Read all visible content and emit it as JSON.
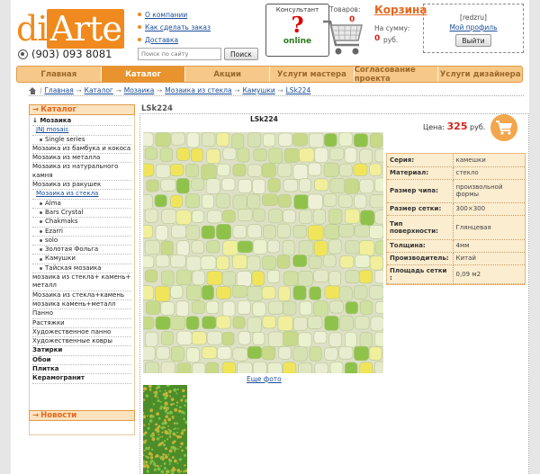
{
  "header": {
    "logo_di": "di",
    "logo_arte": "Arte",
    "phone": "(903) 093 8081",
    "links": [
      "О компании",
      "Как сделать заказ",
      "Доставка"
    ],
    "search_placeholder": "Поиск по сайту",
    "search_button": "Поиск",
    "consultant_title": "Консультант",
    "consultant_status": "online",
    "cart_title": "Корзина",
    "cart_items_label": "Товаров:",
    "cart_items_value": "0",
    "cart_sum_label": "На сумму:",
    "cart_sum_value": "0",
    "cart_sum_unit": "руб.",
    "user_name": "[redzru]",
    "user_profile": "Мой профиль",
    "logout": "Выйти"
  },
  "nav": [
    "Главная",
    "Каталог",
    "Акции",
    "Услуги мастера",
    "Согласование проекта",
    "Услуги дизайнера"
  ],
  "breadcrumb": [
    "Главная",
    "Каталог",
    "Мозаика",
    "Мозаика из стекла",
    "Камушки",
    "LSk224"
  ],
  "sidebar": {
    "title": "Каталог",
    "items": [
      {
        "label": "Мозаика",
        "level": 0,
        "bold": true,
        "arrow": true
      },
      {
        "label": "JNJ mosaic",
        "level": 1,
        "link": true
      },
      {
        "label": "Single series",
        "level": 2
      },
      {
        "label": "Мозаика из бамбука и кокоса",
        "level": 0
      },
      {
        "label": "Мозаика из металла",
        "level": 0
      },
      {
        "label": "Мозаика из натурального камня",
        "level": 0
      },
      {
        "label": "Мозаика из ракушек",
        "level": 0
      },
      {
        "label": "Мозаика из стекла",
        "level": 1,
        "link": true
      },
      {
        "label": "Alma",
        "level": 2
      },
      {
        "label": "Bars Crystal",
        "level": 2
      },
      {
        "label": "Chakmaks",
        "level": 2
      },
      {
        "label": "Ezarri",
        "level": 2
      },
      {
        "label": "solo",
        "level": 2
      },
      {
        "label": "Золотая Фольга",
        "level": 2
      },
      {
        "label": "Камушки",
        "level": 2
      },
      {
        "label": "Тайская мозаика",
        "level": 2
      },
      {
        "label": "мозаика из стекла+ камень+ металл",
        "level": 0
      },
      {
        "label": "Мозаика из стекла+камень",
        "level": 0
      },
      {
        "label": "мозаика камень+металл",
        "level": 0
      },
      {
        "label": "Панно",
        "level": 0
      },
      {
        "label": "Растяжки",
        "level": 0
      },
      {
        "label": "Художественное панно",
        "level": 0
      },
      {
        "label": "Художественные ковры",
        "level": 0
      },
      {
        "label": "Затирки",
        "level": 0,
        "bold": true
      },
      {
        "label": "Обои",
        "level": 0,
        "bold": true
      },
      {
        "label": "Плитка",
        "level": 0,
        "bold": true
      },
      {
        "label": "Керамогранит",
        "level": 0,
        "bold": true
      }
    ],
    "news_title": "Новости"
  },
  "product": {
    "page_title": "LSk224",
    "name": "LSk224",
    "price_label": "Цена:",
    "price_value": "325",
    "price_unit": "руб.",
    "more_photos": "Еще фото",
    "specs": [
      {
        "key": "Серия:",
        "value": "камешки"
      },
      {
        "key": "Материал:",
        "value": "стекло"
      },
      {
        "key": "Размер чипа:",
        "value": "произвольной формы"
      },
      {
        "key": "Размер сетки:",
        "value": "300×300"
      },
      {
        "key": "Тип поверхности:",
        "value": "Глянцевая"
      },
      {
        "key": "Толщина:",
        "value": "4мм"
      },
      {
        "key": "Производитель:",
        "value": "Китай"
      },
      {
        "key": "Площадь сетки :",
        "value": "0,09 м2"
      }
    ]
  },
  "colors": {
    "accent": "#f08a1e",
    "nav_bg": "#f6c88a",
    "price": "#d4261a"
  }
}
